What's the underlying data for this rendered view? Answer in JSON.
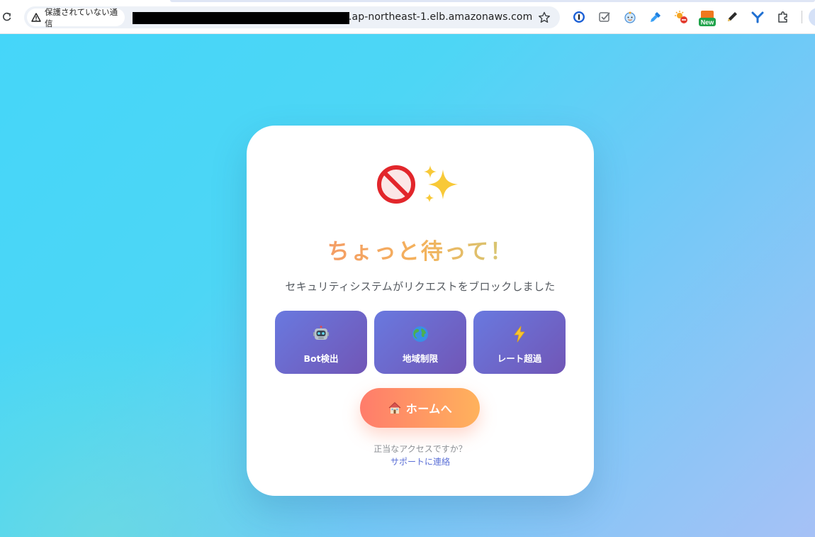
{
  "browser": {
    "security_chip_label": "保護されていない通信",
    "url_suffix": ".ap-northeast-1.elb.amazonaws.com",
    "extensions": [
      "1password-icon",
      "checklist-icon",
      "baby-face-icon",
      "dropper-icon",
      "blocked-sun-icon",
      "new-badge-icon",
      "pen-icon",
      "y-logo-icon",
      "puzzle-icon"
    ],
    "new_badge_label": "New"
  },
  "page": {
    "headline": "ちょっと待って！",
    "subtitle": "セキュリティシステムがリクエストをブロックしました",
    "reasons": [
      {
        "icon": "robot-icon",
        "label": "Bot検出"
      },
      {
        "icon": "globe-icon",
        "label": "地域制限"
      },
      {
        "icon": "lightning-icon",
        "label": "レート超過"
      }
    ],
    "home_button": "ホームへ",
    "footer_question": "正当なアクセスですか？",
    "footer_link": "サポートに連絡"
  }
}
